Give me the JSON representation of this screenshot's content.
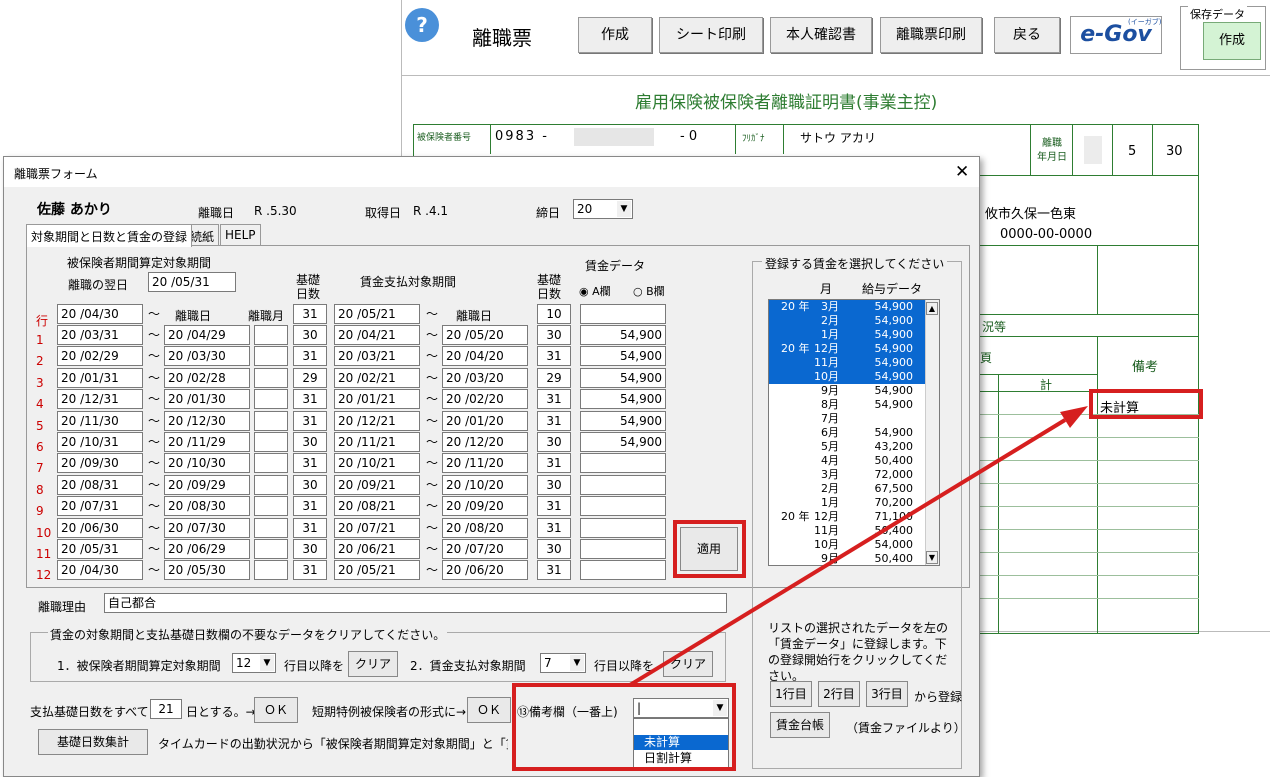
{
  "sheet": {
    "title": "離職票",
    "help": "?",
    "toolbar": [
      "作成",
      "シート印刷",
      "本人確認書",
      "離職票印刷",
      "戻る"
    ],
    "egov": "e-Gov",
    "egov_sub": "(イーガブ)",
    "save_group": "保存データ",
    "save_button": "作成",
    "cert_title": "雇用保険被保険者離職証明書(事業主控)",
    "insured_no_label": "被保険者番号",
    "insured_no_left": "0983 -",
    "insured_no_right": "- 0",
    "furigana_label": "ﾌﾘｶﾞﾅ",
    "furigana": "サトウ アカリ",
    "leave_date_label": "離職\n年月日",
    "leave_month": "5",
    "leave_day": "30",
    "address": "攸市久保一色東",
    "phone": "0000-00-0000",
    "frag_situation": "況等",
    "frag_char": "頁",
    "total": "計",
    "remarks": "備考",
    "remarks_value": "未計算"
  },
  "dialog": {
    "title": "離職票フォーム",
    "close": "✕",
    "name": "佐藤 あかり",
    "leave_label": "離職日",
    "leave_value": "R .5.30",
    "acquire_label": "取得日",
    "acquire_value": "R .4.1",
    "cutoff_label": "締日",
    "cutoff_value": "20",
    "tabs": [
      "対象期間と日数と賃金の登録",
      "続紙",
      "HELP"
    ],
    "period_header": "被保険者期間算定対象期間",
    "next_day_label": "離職の翌日",
    "next_day_value": "20 /05/31",
    "basic_days": "基礎\n日数",
    "pay_period_header": "賃金支払対象期間",
    "basic_days2": "基礎\n日数",
    "wage_data": "賃金データ",
    "radio_a": "A欄",
    "radio_b": "B欄",
    "row_label": "行",
    "leave_col": "離職日",
    "leave_month_col": "離職月",
    "leave_col2": "離職日",
    "tilde": "〜",
    "row0": {
      "from": "20 /04/30",
      "days": "31",
      "pfrom": "20 /05/21",
      "pdays": "10",
      "wage": ""
    },
    "rows": [
      {
        "no": "1",
        "from": "20 /03/31",
        "to": "20 /04/29",
        "days": "30",
        "pfrom": "20 /04/21",
        "pto": "20 /05/20",
        "pdays": "30",
        "wage": "54,900"
      },
      {
        "no": "2",
        "from": "20 /02/29",
        "to": "20 /03/30",
        "days": "31",
        "pfrom": "20 /03/21",
        "pto": "20 /04/20",
        "pdays": "31",
        "wage": "54,900"
      },
      {
        "no": "3",
        "from": "20 /01/31",
        "to": "20 /02/28",
        "days": "29",
        "pfrom": "20 /02/21",
        "pto": "20 /03/20",
        "pdays": "29",
        "wage": "54,900"
      },
      {
        "no": "4",
        "from": "20 /12/31",
        "to": "20 /01/30",
        "days": "31",
        "pfrom": "20 /01/21",
        "pto": "20 /02/20",
        "pdays": "31",
        "wage": "54,900"
      },
      {
        "no": "5",
        "from": "20 /11/30",
        "to": "20 /12/30",
        "days": "31",
        "pfrom": "20 /12/21",
        "pto": "20 /01/20",
        "pdays": "31",
        "wage": "54,900"
      },
      {
        "no": "6",
        "from": "20 /10/31",
        "to": "20 /11/29",
        "days": "30",
        "pfrom": "20 /11/21",
        "pto": "20 /12/20",
        "pdays": "30",
        "wage": "54,900"
      },
      {
        "no": "7",
        "from": "20 /09/30",
        "to": "20 /10/30",
        "days": "31",
        "pfrom": "20 /10/21",
        "pto": "20 /11/20",
        "pdays": "31",
        "wage": ""
      },
      {
        "no": "8",
        "from": "20 /08/31",
        "to": "20 /09/29",
        "days": "30",
        "pfrom": "20 /09/21",
        "pto": "20 /10/20",
        "pdays": "30",
        "wage": ""
      },
      {
        "no": "9",
        "from": "20 /07/31",
        "to": "20 /08/30",
        "days": "31",
        "pfrom": "20 /08/21",
        "pto": "20 /09/20",
        "pdays": "31",
        "wage": ""
      },
      {
        "no": "10",
        "from": "20 /06/30",
        "to": "20 /07/30",
        "days": "31",
        "pfrom": "20 /07/21",
        "pto": "20 /08/20",
        "pdays": "31",
        "wage": ""
      },
      {
        "no": "11",
        "from": "20 /05/31",
        "to": "20 /06/29",
        "days": "30",
        "pfrom": "20 /06/21",
        "pto": "20 /07/20",
        "pdays": "30",
        "wage": ""
      },
      {
        "no": "12",
        "from": "20 /04/30",
        "to": "20 /05/30",
        "days": "31",
        "pfrom": "20 /05/21",
        "pto": "20 /06/20",
        "pdays": "31",
        "wage": ""
      }
    ],
    "apply": "適用",
    "reason_label": "離職理由",
    "reason_value": "自己都合",
    "clear_group": "賃金の対象期間と支払基礎日数欄の不要なデータをクリアしてください。",
    "clear1_label": "1．被保険者期間算定対象期間",
    "clear1_value": "12",
    "clear_suffix": "行目以降を",
    "clear_btn": "クリア",
    "clear2_label": "2．賃金支払対象期間",
    "clear2_value": "7",
    "clear2_suffix": "行目以降を",
    "clear2_btn": "クリア",
    "all_days_label": "支払基礎日数をすべて",
    "all_days_value": "21",
    "all_days_suffix": "日とする。→",
    "ok1": "ＯＫ",
    "short_label": "短期特例被保険者の形式に→",
    "ok2": "ＯＫ",
    "remarks_label": "⑬備考欄（一番上)",
    "remarks_value": "|",
    "remarks_options": [
      "未計算",
      "日割計算"
    ],
    "calc_btn": "基礎日数集計",
    "calc_desc": "タイムカードの出勤状況から「被保険者期間算定対象期間」と「賃金支払対象期間」の「基礎日数」",
    "wage_group": "登録する賃金を選択してください",
    "list_month": "月",
    "list_pay": "給与データ",
    "list": [
      {
        "y": "20 年",
        "m": "3月",
        "v": "54,900",
        "s": true
      },
      {
        "y": "",
        "m": "2月",
        "v": "54,900",
        "s": true
      },
      {
        "y": "",
        "m": "1月",
        "v": "54,900",
        "s": true
      },
      {
        "y": "20 年",
        "m": "12月",
        "v": "54,900",
        "s": true
      },
      {
        "y": "",
        "m": "11月",
        "v": "54,900",
        "s": true
      },
      {
        "y": "",
        "m": "10月",
        "v": "54,900",
        "s": true
      },
      {
        "y": "",
        "m": "9月",
        "v": "54,900",
        "s": false
      },
      {
        "y": "",
        "m": "8月",
        "v": "54,900",
        "s": false
      },
      {
        "y": "",
        "m": "7月",
        "v": "",
        "s": false
      },
      {
        "y": "",
        "m": "6月",
        "v": "54,900",
        "s": false
      },
      {
        "y": "",
        "m": "5月",
        "v": "43,200",
        "s": false
      },
      {
        "y": "",
        "m": "4月",
        "v": "50,400",
        "s": false
      },
      {
        "y": "",
        "m": "3月",
        "v": "72,000",
        "s": false
      },
      {
        "y": "",
        "m": "2月",
        "v": "67,500",
        "s": false
      },
      {
        "y": "",
        "m": "1月",
        "v": "70,200",
        "s": false
      },
      {
        "y": "20 年",
        "m": "12月",
        "v": "71,100",
        "s": false
      },
      {
        "y": "",
        "m": "11月",
        "v": "50,400",
        "s": false
      },
      {
        "y": "",
        "m": "10月",
        "v": "54,000",
        "s": false
      },
      {
        "y": "",
        "m": "9月",
        "v": "50,400",
        "s": false
      }
    ],
    "list_note": "リストの選択されたデータを左の「賃金データ」に登録します。下の登録開始行をクリックしてください。",
    "reg_btns": [
      "1行目",
      "2行目",
      "3行目"
    ],
    "reg_suffix": "から登録",
    "ledger_btn": "賃金台帳",
    "ledger_note": "（賃金ファイルより）"
  }
}
